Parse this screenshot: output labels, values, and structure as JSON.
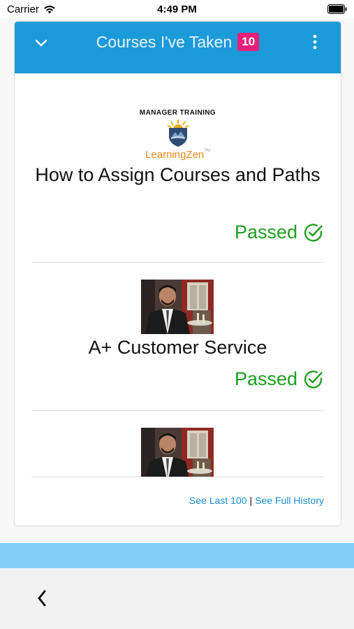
{
  "status_bar": {
    "carrier": "Carrier",
    "time": "4:49 PM"
  },
  "header": {
    "title": "Courses I've Taken",
    "count_badge": "10",
    "colors": {
      "bar": "#1b9ad9",
      "badge": "#e8207a"
    }
  },
  "courses": [
    {
      "logo_caption": "MANAGER TRAINING",
      "logo_brand": "LearningZen",
      "logo_trademark": "TM",
      "title": "How to Assign Courses and Paths",
      "status": "Passed",
      "status_icon": "check-circle-icon"
    },
    {
      "image": "waiter-photo",
      "title": "A+ Customer Service",
      "status": "Passed",
      "status_icon": "check-circle-icon"
    },
    {
      "image": "waiter-photo",
      "title": "",
      "status": ""
    }
  ],
  "footer": {
    "see_last_label": "See Last 100",
    "separator": "|",
    "see_full_label": "See Full History"
  },
  "icons": {
    "collapse": "chevron-down-icon",
    "menu": "more-vertical-icon",
    "back": "chevron-left-icon"
  },
  "status_color": "#1e9e1e",
  "link_color": "#1b8fd6"
}
